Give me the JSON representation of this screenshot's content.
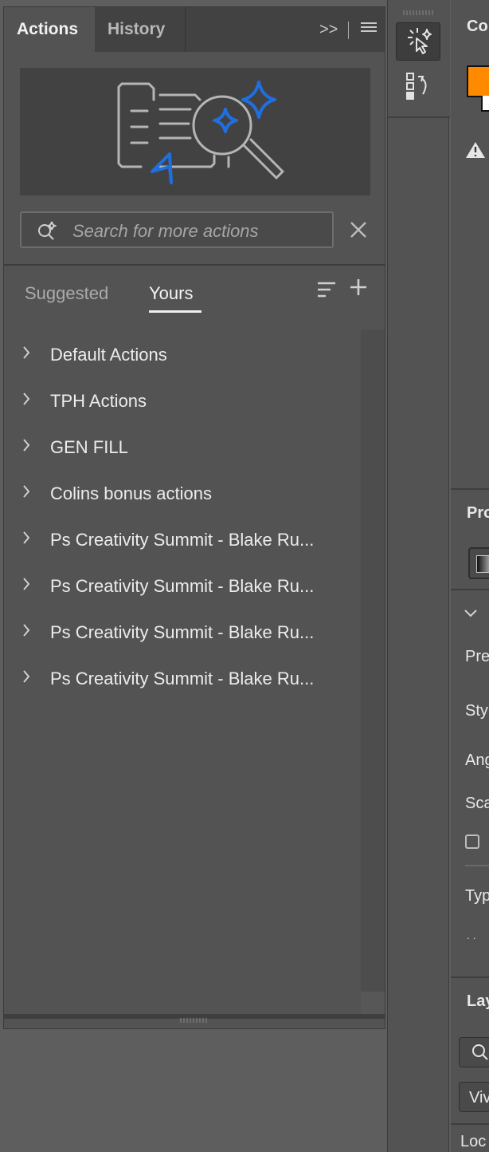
{
  "tabs": {
    "actions": "Actions",
    "history": "History",
    "collapse": ">>"
  },
  "search": {
    "placeholder": "Search for more actions"
  },
  "subtabs": {
    "suggested": "Suggested",
    "yours": "Yours"
  },
  "action_sets": [
    {
      "label": "Default Actions"
    },
    {
      "label": "TPH Actions"
    },
    {
      "label": "GEN FILL"
    },
    {
      "label": "Colins bonus actions"
    },
    {
      "label": "Ps Creativity Summit - Blake Ru..."
    },
    {
      "label": "Ps Creativity Summit - Blake Ru..."
    },
    {
      "label": "Ps Creativity Summit - Blake Ru..."
    },
    {
      "label": "Ps Creativity Summit - Blake Ru..."
    }
  ],
  "right_panels": {
    "color_title": "Co",
    "properties_title": "Pro",
    "props": [
      "Pre",
      "Sty",
      "Ang",
      "Sca",
      "Typ"
    ],
    "layers_title": "Lay",
    "layers_mode": "Viv",
    "lock_label": "Loc"
  },
  "colors": {
    "accent_blue": "#1f6fe0",
    "foreground_swatch": "#ff8a00",
    "panel_bg": "#535353"
  }
}
